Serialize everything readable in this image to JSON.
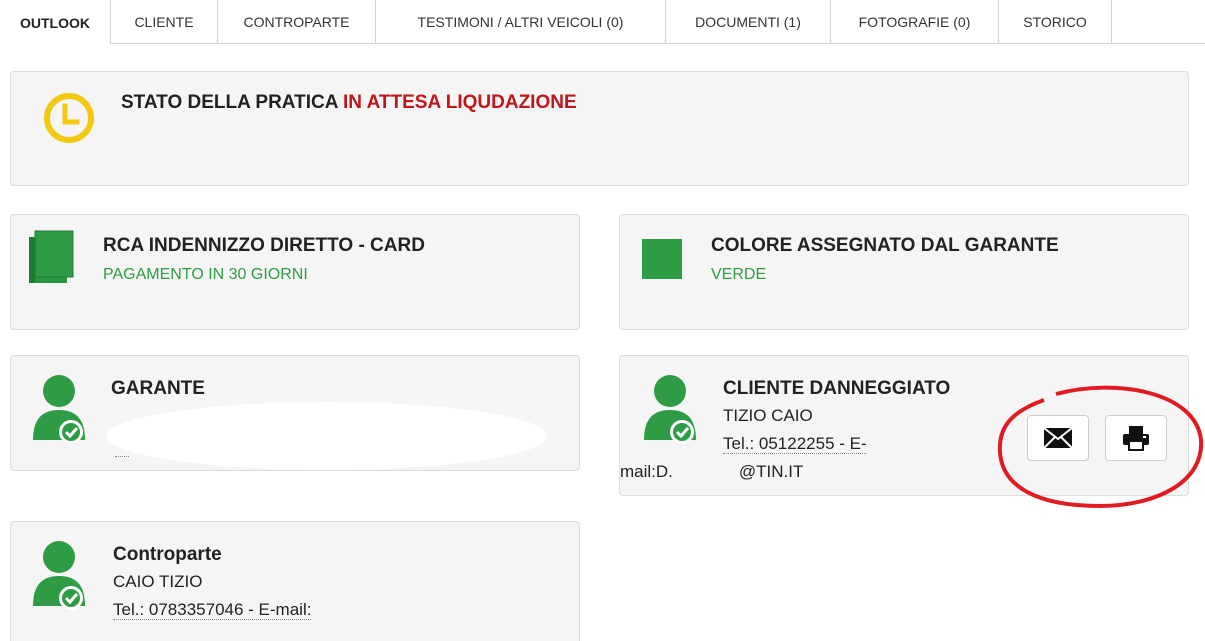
{
  "tabs": [
    {
      "label": "OUTLOOK"
    },
    {
      "label": "CLIENTE"
    },
    {
      "label": "CONTROPARTE"
    },
    {
      "label": "TESTIMONI / ALTRI VEICOLI (0)"
    },
    {
      "label": "DOCUMENTI (1)"
    },
    {
      "label": "FOTOGRAFIE (0)"
    },
    {
      "label": "STORICO"
    }
  ],
  "stato": {
    "title": "STATO DELLA PRATICA",
    "value": "IN ATTESA LIQUDAZIONE",
    "icon": "clock-icon"
  },
  "rca": {
    "title": "RCA INDENNIZZO DIRETTO - CARD",
    "subtitle": "PAGAMENTO IN 30 GIORNI",
    "icon": "book-icon"
  },
  "colore": {
    "title": "COLORE ASSEGNATO DAL GARANTE",
    "subtitle": "VERDE",
    "icon": "green-square-icon"
  },
  "garante": {
    "title": "GARANTE",
    "icon": "user-check-icon"
  },
  "cliente": {
    "title": "CLIENTE DANNEGGIATO",
    "name": "TIZIO CAIO",
    "tel": "Tel.: 05122255 - E-",
    "email_prefix": "mail:D.",
    "email_suffix": "@TIN.IT",
    "icon": "user-check-icon",
    "buttons": [
      {
        "icon": "envelope-icon"
      },
      {
        "icon": "print-icon"
      }
    ]
  },
  "controparte": {
    "title": "Controparte",
    "name": "CAIO TIZIO",
    "tel": "Tel.: 0783357046 - E-mail:",
    "icon": "user-check-icon"
  },
  "colors": {
    "green": "#2e9c45",
    "red": "#c0151b",
    "yellow": "#f2c811",
    "annotation": "#e01b24"
  }
}
